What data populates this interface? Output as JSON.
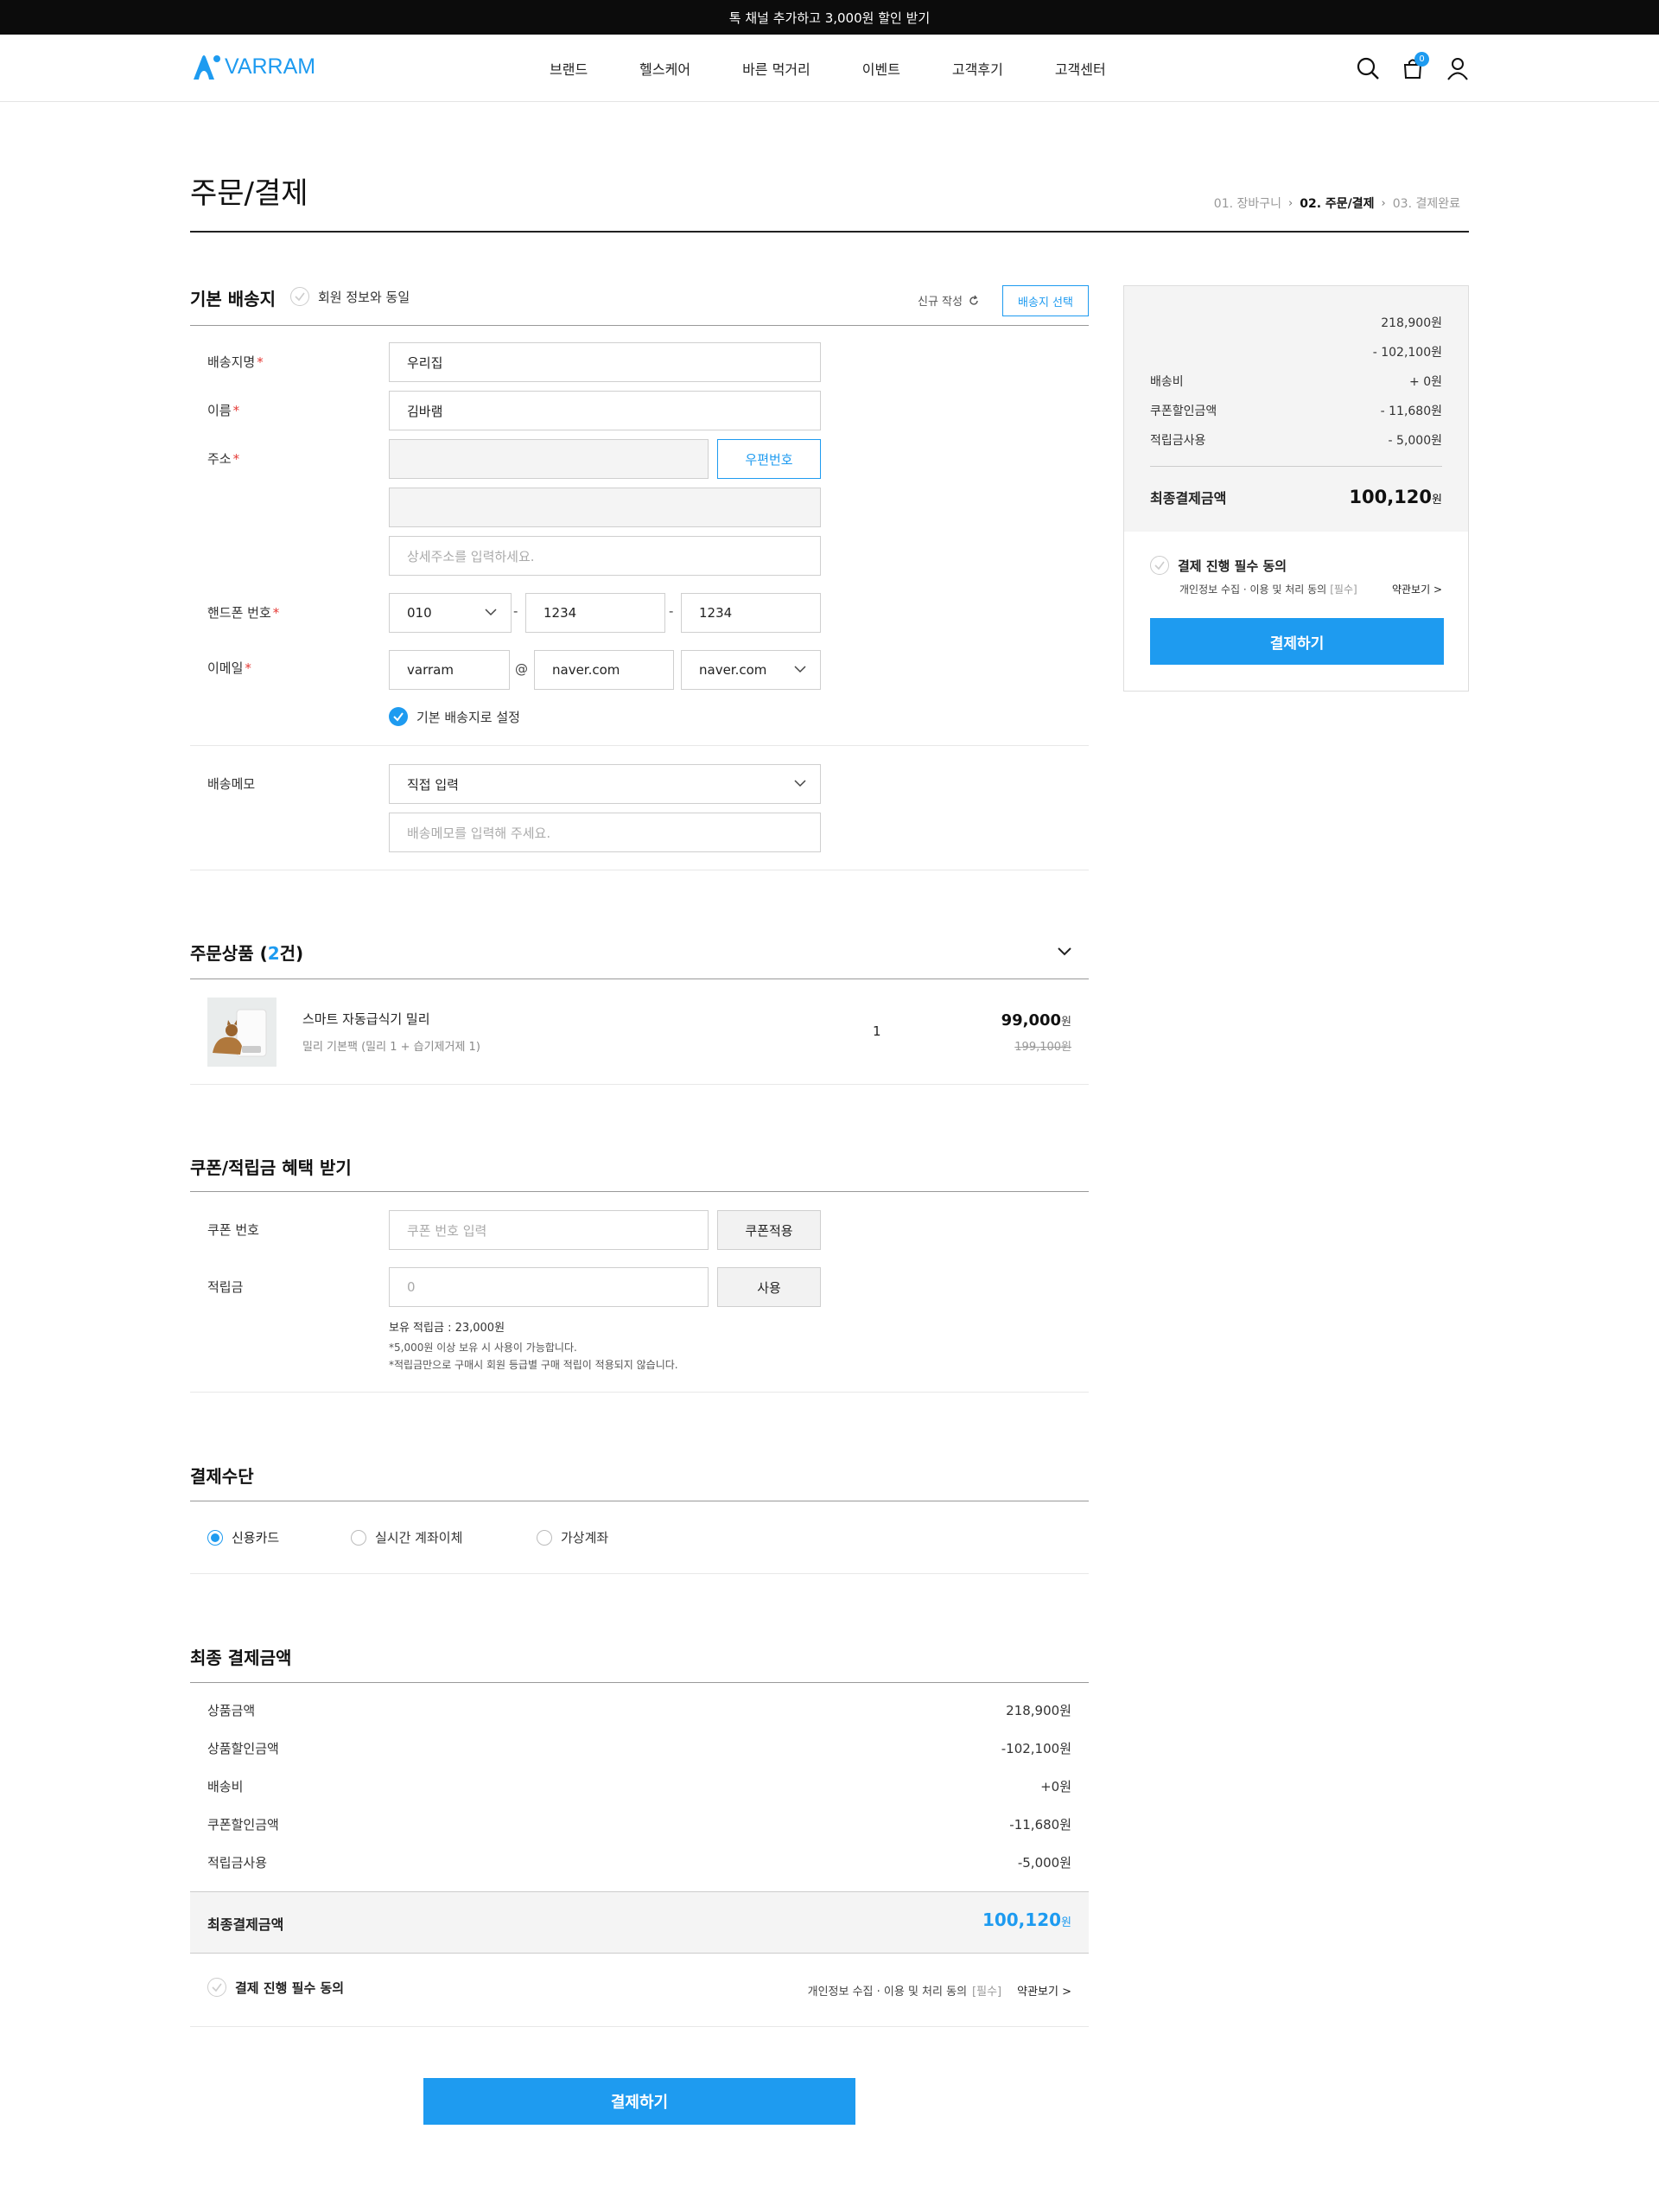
{
  "topbar": {
    "text": "톡 채널 추가하고 3,000원 할인 받기"
  },
  "header": {
    "logo": "VARRAM",
    "nav": [
      "브랜드",
      "헬스케어",
      "바른 먹거리",
      "이벤트",
      "고객후기",
      "고객센터"
    ],
    "cart_count": "0"
  },
  "page": {
    "title": "주문/결제",
    "steps": [
      "01. 장바구니",
      "02. 주문/결제",
      "03. 결제완료"
    ]
  },
  "shipping": {
    "heading": "기본 배송지",
    "same_as_member": "회원 정보와 동일",
    "new_entry": "신규 작성",
    "select_button": "배송지 선택",
    "fields": {
      "place_label": "배송지명",
      "place_value": "우리집",
      "name_label": "이름",
      "name_value": "김바램",
      "address_label": "주소",
      "zipcode_button": "우편번호",
      "detail_placeholder": "상세주소를 입력하세요.",
      "phone_label": "핸드폰 번호",
      "phone1": "010",
      "phone2": "1234",
      "phone3": "1234",
      "email_label": "이메일",
      "email_id": "varram",
      "email_at": "@",
      "email_domain": "naver.com",
      "email_select": "naver.com",
      "default_check": "기본 배송지로 설정",
      "memo_label": "배송메모",
      "memo_select": "직접 입력",
      "memo_placeholder": "배송메모를 입력해 주세요."
    },
    "required_mark": "*",
    "dash": "-"
  },
  "order": {
    "heading": "주문상품",
    "count_open": "(",
    "count": "2",
    "count_close": "건)",
    "item": {
      "name": "스마트 자동급식기 밀리",
      "option": "밀리 기본팩 (밀리 1 + 습기제거제 1)",
      "qty": "1",
      "price": "99,000",
      "price_unit": "원",
      "original": "199,100원"
    }
  },
  "coupon": {
    "heading": "쿠폰/적립금 혜택 받기",
    "coupon_label": "쿠폰 번호",
    "coupon_placeholder": "쿠폰 번호 입력",
    "coupon_button": "쿠폰적용",
    "point_label": "적립금",
    "point_placeholder": "0",
    "point_button": "사용",
    "balance": "보유 적립금 : 23,000원",
    "note1": "*5,000원 이상 보유 시 사용이 가능합니다.",
    "note2": "*적립금만으로 구매시 회원 등급별 구매 적립이 적용되지 않습니다."
  },
  "payment": {
    "heading": "결제수단",
    "methods": [
      "신용카드",
      "실시간 계좌이체",
      "가상계좌"
    ]
  },
  "final": {
    "heading": "최종 결제금액",
    "rows": [
      {
        "label": "상품금액",
        "value": "218,900원"
      },
      {
        "label": "상품할인금액",
        "value": "-102,100원"
      },
      {
        "label": "배송비",
        "value": "+0원"
      },
      {
        "label": "쿠폰할인금액",
        "value": "-11,680원"
      },
      {
        "label": "적립금사용",
        "value": "-5,000원"
      }
    ],
    "total_label": "최종결제금액",
    "total_value": "100,120",
    "total_unit": "원",
    "agree": "결제 진행 필수 동의",
    "privacy": "개인정보 수집 · 이용 및 처리 동의",
    "required": "[필수]",
    "terms_link": "약관보기 >",
    "pay_button": "결제하기"
  },
  "summary": {
    "rows": [
      {
        "label": "",
        "value": "218,900원"
      },
      {
        "label": "",
        "value": "- 102,100원"
      },
      {
        "label": "배송비",
        "value": "+ 0원"
      },
      {
        "label": "쿠폰할인금액",
        "value": "- 11,680원"
      },
      {
        "label": "적립금사용",
        "value": "- 5,000원"
      }
    ],
    "total_label": "최종결제금액",
    "total_value": "100,120",
    "total_unit": "원",
    "agree": "결제 진행 필수 동의",
    "privacy": "개인정보 수집 · 이용 및 처리 동의",
    "required": "[필수]",
    "terms_link": "약관보기 >",
    "pay_button": "결제하기"
  },
  "colors": {
    "accent": "#1e9bf0",
    "topbar": "#0c0c0c",
    "required": "#e53935"
  }
}
